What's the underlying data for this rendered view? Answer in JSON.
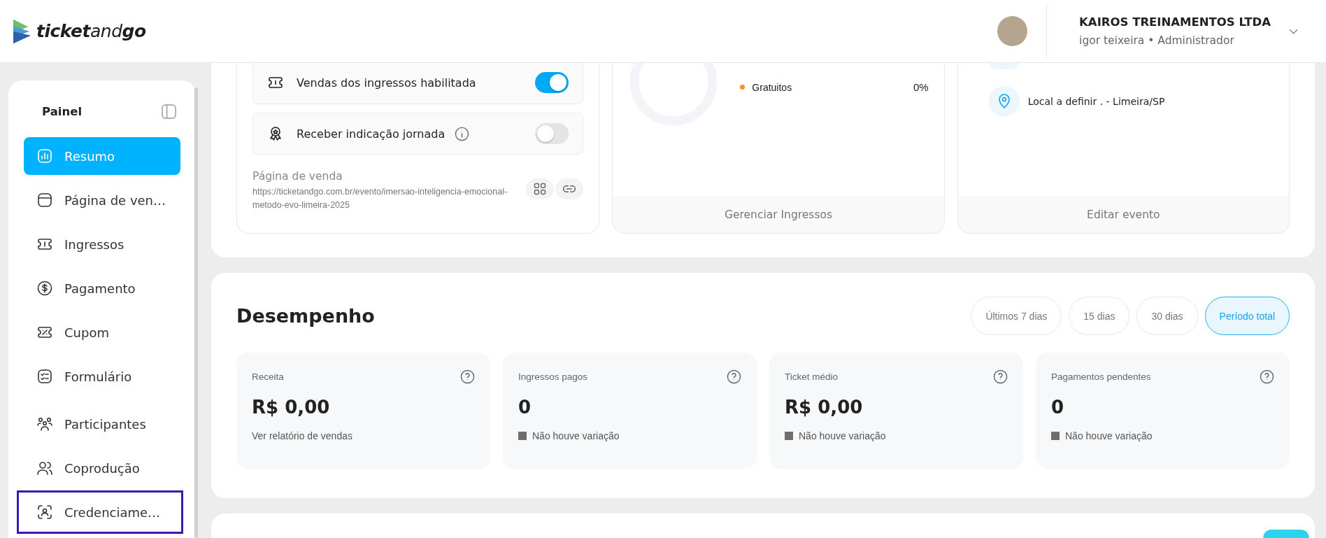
{
  "header": {
    "logo": "**ticket**and**go**",
    "account": {
      "company": "KAIROS TREINAMENTOS LTDA",
      "user": "igor teixeira • Administrador"
    }
  },
  "sidebar": {
    "title": "Painel",
    "groups": [
      [
        {
          "label": "Resumo",
          "selected": true,
          "highlighted": false
        },
        {
          "label": "Página de ven…",
          "selected": false,
          "highlighted": false
        },
        {
          "label": "Ingressos",
          "selected": false,
          "highlighted": false
        },
        {
          "label": "Pagamento",
          "selected": false,
          "highlighted": false
        },
        {
          "label": "Cupom",
          "selected": false,
          "highlighted": false
        },
        {
          "label": "Formulário",
          "selected": false,
          "highlighted": false
        }
      ],
      [
        {
          "label": "Participantes",
          "selected": false,
          "highlighted": false
        },
        {
          "label": "Coprodução",
          "selected": false,
          "highlighted": false
        },
        {
          "label": "Credenciame…",
          "selected": false,
          "highlighted": true
        }
      ]
    ]
  },
  "event": {
    "toggles": [
      {
        "label": "Vendas dos ingressos habilitada",
        "checked": true,
        "info": false
      },
      {
        "label": "Receber indicação jornada",
        "checked": false,
        "info": true
      }
    ],
    "sales_page": {
      "label": "Página de venda",
      "url": "https://ticketandgo.com.br/evento/imersao-inteligencia-emocional-metodo-evo-limeira-2025"
    },
    "tickets_card": {
      "legend": [
        {
          "label": "Gratuitos",
          "value": "0%",
          "color": "#f7941d"
        }
      ],
      "footer": "Gerenciar Ingressos"
    },
    "details_card": {
      "location": "Local a definir . - Limeira/SP",
      "footer": "Editar evento"
    }
  },
  "performance": {
    "title": "Desempenho",
    "filters": [
      {
        "label": "Últimos 7 dias",
        "selected": false
      },
      {
        "label": "15 dias",
        "selected": false
      },
      {
        "label": "30 dias",
        "selected": false
      },
      {
        "label": "Período total",
        "selected": true
      }
    ],
    "metrics": [
      {
        "label": "Receita",
        "value": "R$ 0,00",
        "kind": "link",
        "footer": "Ver relatório de vendas"
      },
      {
        "label": "Ingressos pagos",
        "value": "0",
        "kind": "variation",
        "footer": "Não houve variação"
      },
      {
        "label": "Ticket médio",
        "value": "R$ 0,00",
        "kind": "variation",
        "footer": "Não houve variação"
      },
      {
        "label": "Pagamentos pendentes",
        "value": "0",
        "kind": "variation",
        "footer": "Não houve variação"
      }
    ]
  }
}
